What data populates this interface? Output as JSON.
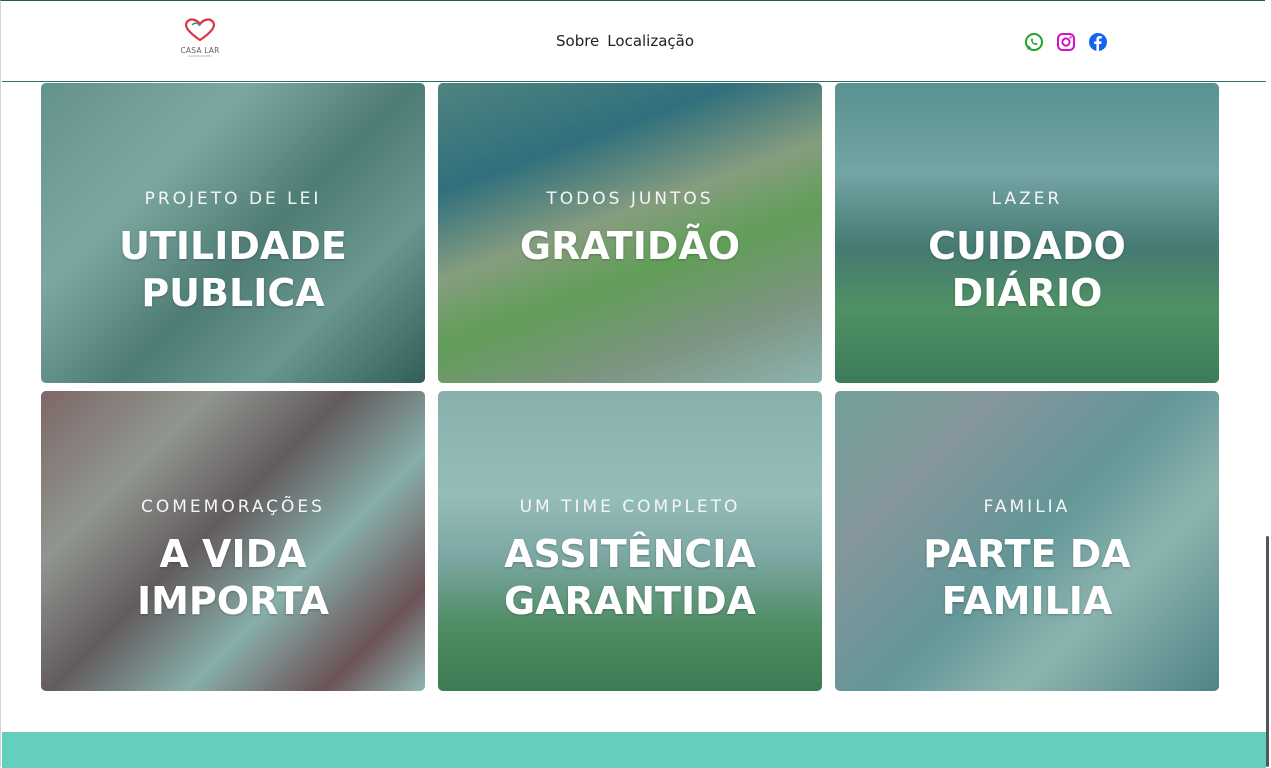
{
  "header": {
    "logo": {
      "text": "CASA LAR",
      "subtext": "SAO JUDAS TADEU",
      "icon": "heart-logo-icon"
    },
    "nav": [
      {
        "label": "Sobre"
      },
      {
        "label": "Localização"
      }
    ],
    "social": [
      {
        "name": "whatsapp-icon",
        "color": "#25a02c"
      },
      {
        "name": "instagram-icon",
        "color": "#d015c8"
      },
      {
        "name": "facebook-icon",
        "color": "#1463f3"
      }
    ]
  },
  "cards": [
    {
      "kicker": "PROJETO DE LEI",
      "title": "UTILIDADE\nPUBLICA"
    },
    {
      "kicker": "TODOS JUNTOS",
      "title": "GRATIDÃO"
    },
    {
      "kicker": "LAZER",
      "title": "CUIDADO\nDIÁRIO"
    },
    {
      "kicker": "COMEMORAÇÕES",
      "title": "A VIDA\nIMPORTA"
    },
    {
      "kicker": "UM TIME COMPLETO",
      "title": "ASSITÊNCIA\nGARANTIDA"
    },
    {
      "kicker": "FAMILIA",
      "title": "PARTE DA\nFAMILIA"
    }
  ],
  "colors": {
    "overlay": "#1e786e",
    "footer": "#63cfbc",
    "header_border": "#2f6f66"
  }
}
